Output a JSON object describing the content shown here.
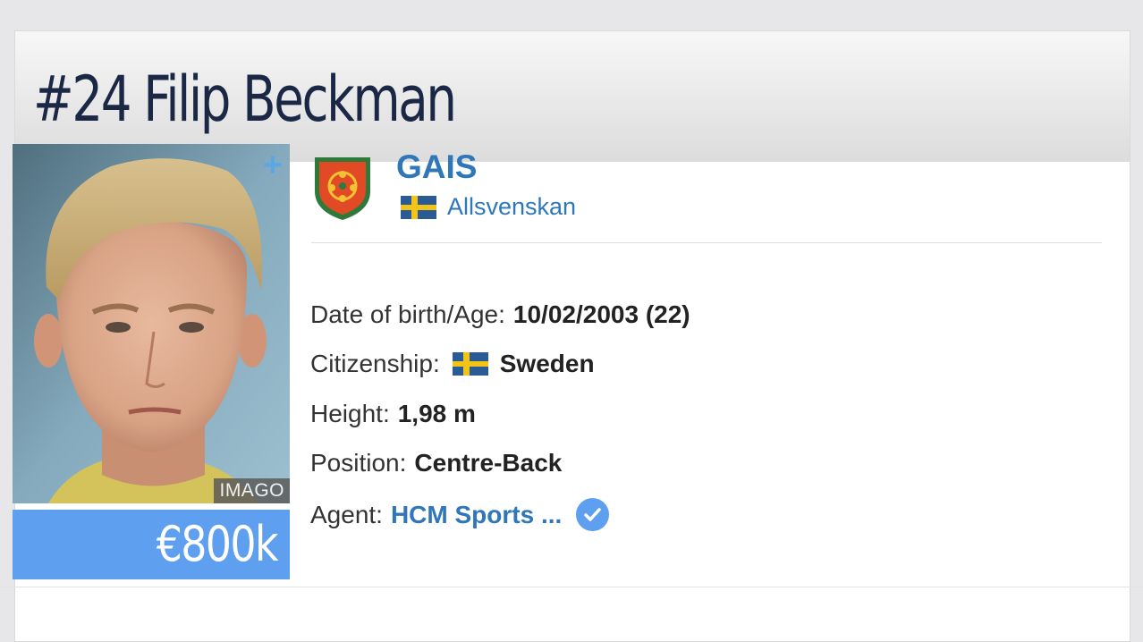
{
  "header": {
    "title": "#24 Filip Beckman"
  },
  "photo": {
    "credit": "IMAGO",
    "icon": "plus-icon"
  },
  "market_value": {
    "value": "€800k"
  },
  "club": {
    "name": "GAIS",
    "league": "Allsvenskan",
    "league_flag": "sweden-flag"
  },
  "details": {
    "dob_label": "Date of birth/Age:",
    "dob_value": "10/02/2003 (22)",
    "citizenship_label": "Citizenship:",
    "citizenship_value": "Sweden",
    "height_label": "Height:",
    "height_value": "1,98 m",
    "position_label": "Position:",
    "position_value": "Centre-Back",
    "agent_label": "Agent:",
    "agent_value": "HCM Sports ...",
    "agent_verified_icon": "verified-check-icon"
  },
  "colors": {
    "accent": "#2f77b8",
    "value_box": "#5e9ff0",
    "title": "#1a2846"
  }
}
